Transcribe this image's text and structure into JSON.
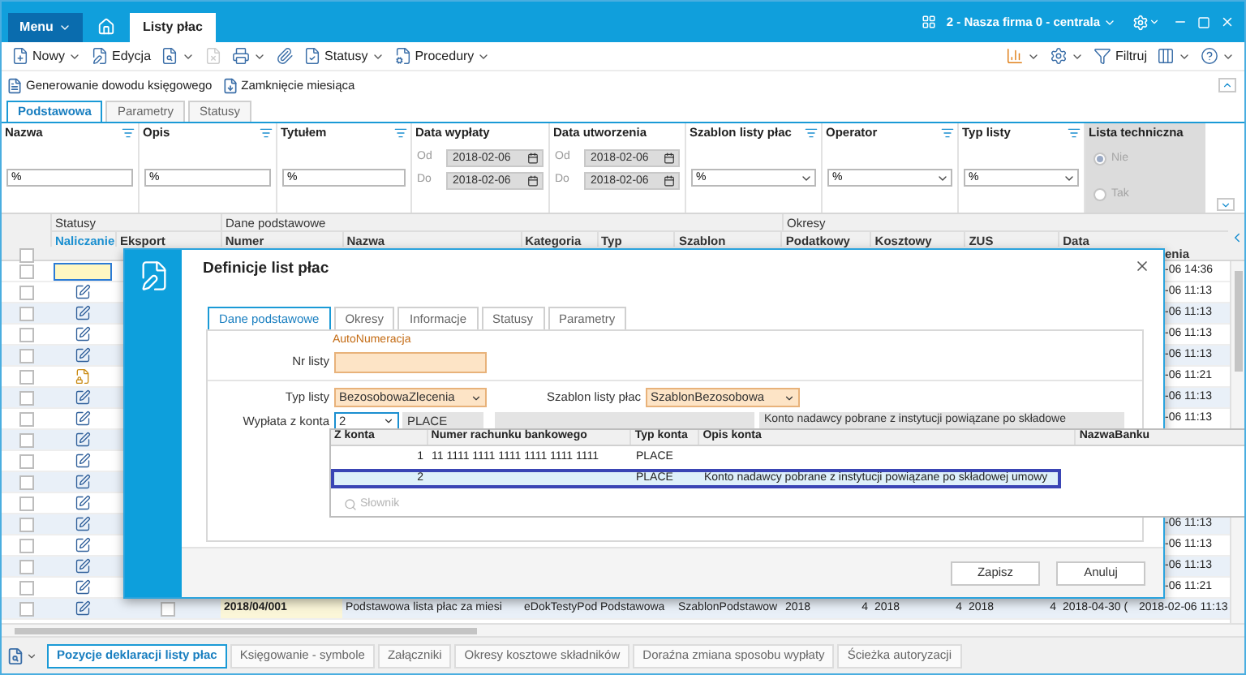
{
  "app_bar": {
    "menu": "Menu",
    "tab": "Listy płac",
    "company": "2 - Nasza firma 0 - centrala"
  },
  "toolbar": [
    {
      "kind": "new",
      "label": "Nowy",
      "dropdown": true,
      "disabled": false
    },
    {
      "kind": "edit",
      "label": "Edycja",
      "dropdown": false,
      "disabled": false
    },
    {
      "kind": "preview",
      "dropdown": true,
      "disabled": false
    },
    {
      "kind": "delete",
      "dropdown": false,
      "disabled": true
    },
    {
      "kind": "print",
      "dropdown": true,
      "disabled": false
    },
    {
      "kind": "attach",
      "dropdown": false,
      "disabled": false
    },
    {
      "kind": "status",
      "label": "Statusy",
      "dropdown": true,
      "disabled": false
    },
    {
      "kind": "procedure",
      "label": "Procedury",
      "dropdown": true,
      "disabled": false
    }
  ],
  "toolbar_right": [
    {
      "kind": "chart",
      "dropdown": true
    },
    {
      "kind": "config",
      "dropdown": true
    },
    {
      "kind": "filter",
      "label": "Filtruj",
      "dropdown": false
    },
    {
      "kind": "columns",
      "dropdown": true
    },
    {
      "kind": "help",
      "dropdown": true
    }
  ],
  "actions": [
    {
      "kind": "document",
      "label": "Generowanie dowodu księgowego"
    },
    {
      "kind": "close-month",
      "label": "Zamknięcie miesiąca"
    }
  ],
  "filter_tabs": [
    {
      "label": "Podstawowa",
      "selected": true
    },
    {
      "label": "Parametry",
      "selected": false
    },
    {
      "label": "Statusy",
      "selected": false
    }
  ],
  "filters": [
    {
      "kind": "text",
      "label": "Nazwa",
      "value": "%"
    },
    {
      "kind": "text",
      "label": "Opis",
      "value": "%"
    },
    {
      "kind": "text",
      "label": "Tytułem",
      "value": "%"
    },
    {
      "kind": "date",
      "label": "Data wypłaty",
      "from_label": "Od",
      "from": "2018-02-06",
      "to_label": "Do",
      "to": "2018-02-06"
    },
    {
      "kind": "date",
      "label": "Data utworzenia",
      "from_label": "Od",
      "from": "2018-02-06",
      "to_label": "Do",
      "to": "2018-02-06"
    },
    {
      "kind": "select",
      "label": "Szablon listy płac",
      "value": "%"
    },
    {
      "kind": "select",
      "label": "Operator",
      "value": "%"
    },
    {
      "kind": "select",
      "label": "Typ listy",
      "value": "%"
    },
    {
      "kind": "radio",
      "label": "Lista techniczna",
      "options": [
        {
          "label": "Nie",
          "selected": true
        },
        {
          "label": "Tak",
          "selected": false
        }
      ]
    }
  ],
  "grid": {
    "groups": [
      {
        "label": "Statusy"
      },
      {
        "label": "Dane podstawowe"
      },
      {
        "label": "Okresy"
      }
    ],
    "columns": [
      {
        "label": "Naliczanie",
        "sorted": true
      },
      {
        "label": "Eksport",
        "sorted": false
      },
      {
        "label": "Numer",
        "sorted": false
      },
      {
        "label": "Nazwa",
        "sorted": false
      },
      {
        "label": "Kategoria",
        "sorted": false
      },
      {
        "label": "Typ",
        "sorted": false
      },
      {
        "label": "Szablon",
        "sorted": false
      },
      {
        "label": "Podatkowy",
        "sorted": false
      },
      {
        "label": "Kosztowy",
        "sorted": false
      },
      {
        "label": "ZUS",
        "sorted": false
      },
      {
        "label": "Data",
        "sorted": false
      }
    ],
    "sub_header": "enia",
    "select_all_checked": false,
    "rows": [
      {
        "kind": "partial",
        "checked": false,
        "current": true,
        "time": "-06 14:36"
      },
      {
        "kind": "partial",
        "checked": false,
        "current": false,
        "locked": false,
        "time": "-06 11:13"
      },
      {
        "kind": "partial",
        "checked": false,
        "current": false,
        "locked": false,
        "time": "-06 11:13"
      },
      {
        "kind": "partial",
        "checked": false,
        "current": false,
        "locked": false,
        "time": "-06 11:13"
      },
      {
        "kind": "partial",
        "checked": false,
        "current": false,
        "locked": false,
        "time": "-06 11:13"
      },
      {
        "kind": "partial",
        "checked": false,
        "current": false,
        "locked": true,
        "time": "-06 11:21"
      },
      {
        "kind": "partial",
        "checked": false,
        "current": false,
        "locked": false,
        "time": "-06 11:13"
      },
      {
        "kind": "partial",
        "checked": false,
        "current": false,
        "locked": false,
        "time": "-06 11:13"
      },
      {
        "kind": "partial",
        "checked": false,
        "current": false,
        "locked": false
      },
      {
        "kind": "partial",
        "checked": false,
        "current": false,
        "locked": false
      },
      {
        "kind": "partial",
        "checked": false,
        "current": false,
        "locked": false
      },
      {
        "kind": "partial",
        "checked": false,
        "current": false,
        "locked": false
      },
      {
        "kind": "partial",
        "checked": false,
        "current": false,
        "locked": false,
        "time": "-06 11:13"
      },
      {
        "kind": "partial",
        "checked": false,
        "current": false,
        "locked": false,
        "time": "-06 11:13"
      },
      {
        "kind": "partial",
        "checked": false,
        "current": false,
        "locked": false,
        "time": "-06 11:13"
      },
      {
        "kind": "partial",
        "checked": false,
        "current": false,
        "locked": false,
        "time": "-06 11:21"
      },
      {
        "kind": "full",
        "checked": false,
        "current": false,
        "locked": false,
        "export_checked": false,
        "cells": [
          "2018/04/001",
          "Podstawowa lista płac za miesi",
          "eDokTestyPod",
          "Podstawowa",
          "SzablonPodstawow",
          "2018",
          "4",
          "2018",
          "4",
          "2018",
          "4",
          "2018-04-30 (",
          "2018-02-06 11:13"
        ]
      }
    ]
  },
  "dialog": {
    "title": "Definicje list płac",
    "tabs": [
      {
        "label": "Dane podstawowe",
        "selected": true
      },
      {
        "label": "Okresy",
        "selected": false
      },
      {
        "label": "Informacje",
        "selected": false
      },
      {
        "label": "Statusy",
        "selected": false
      },
      {
        "label": "Parametry",
        "selected": false
      }
    ],
    "auto_label": "AutoNumeracja",
    "nr_listy": {
      "label": "Nr listy"
    },
    "typ_listy": {
      "label": "Typ listy",
      "value": "BezosobowaZlecenia"
    },
    "szablon": {
      "label": "Szablon listy płac",
      "value": "SzablonBezosobowa"
    },
    "wyplata": {
      "label": "Wypłata z konta",
      "value": "2",
      "account_type": "PLACE",
      "description": "Konto nadawcy pobrane z instytucji powiązane po składowe"
    },
    "account_list": {
      "columns": [
        "Z konta",
        "Numer rachunku bankowego",
        "Typ konta",
        "Opis konta",
        "NazwaBanku"
      ],
      "rows": [
        {
          "number": "1",
          "account": "11 1111 1111 1111 1111 1111 1111",
          "type": "PLACE",
          "selected": false
        },
        {
          "number": "2",
          "type": "PLACE",
          "description": "Konto nadawcy pobrane z instytucji powiązane po składowej umowy",
          "selected": true
        }
      ],
      "dictionary": {
        "label": "Słownik",
        "disabled": true
      }
    },
    "buttons": [
      "Zapisz",
      "Anuluj"
    ]
  },
  "bottom_tabs": [
    {
      "label": "Pozycje deklaracji listy płac",
      "selected": true
    },
    {
      "label": "Księgowanie - symbole",
      "selected": false
    },
    {
      "label": "Załączniki",
      "selected": false
    },
    {
      "label": "Okresy kosztowe składników",
      "selected": false
    },
    {
      "label": "Doraźna zmiana sposobu wypłaty",
      "selected": false
    },
    {
      "label": "Ścieżka autoryzacji",
      "selected": false
    }
  ]
}
